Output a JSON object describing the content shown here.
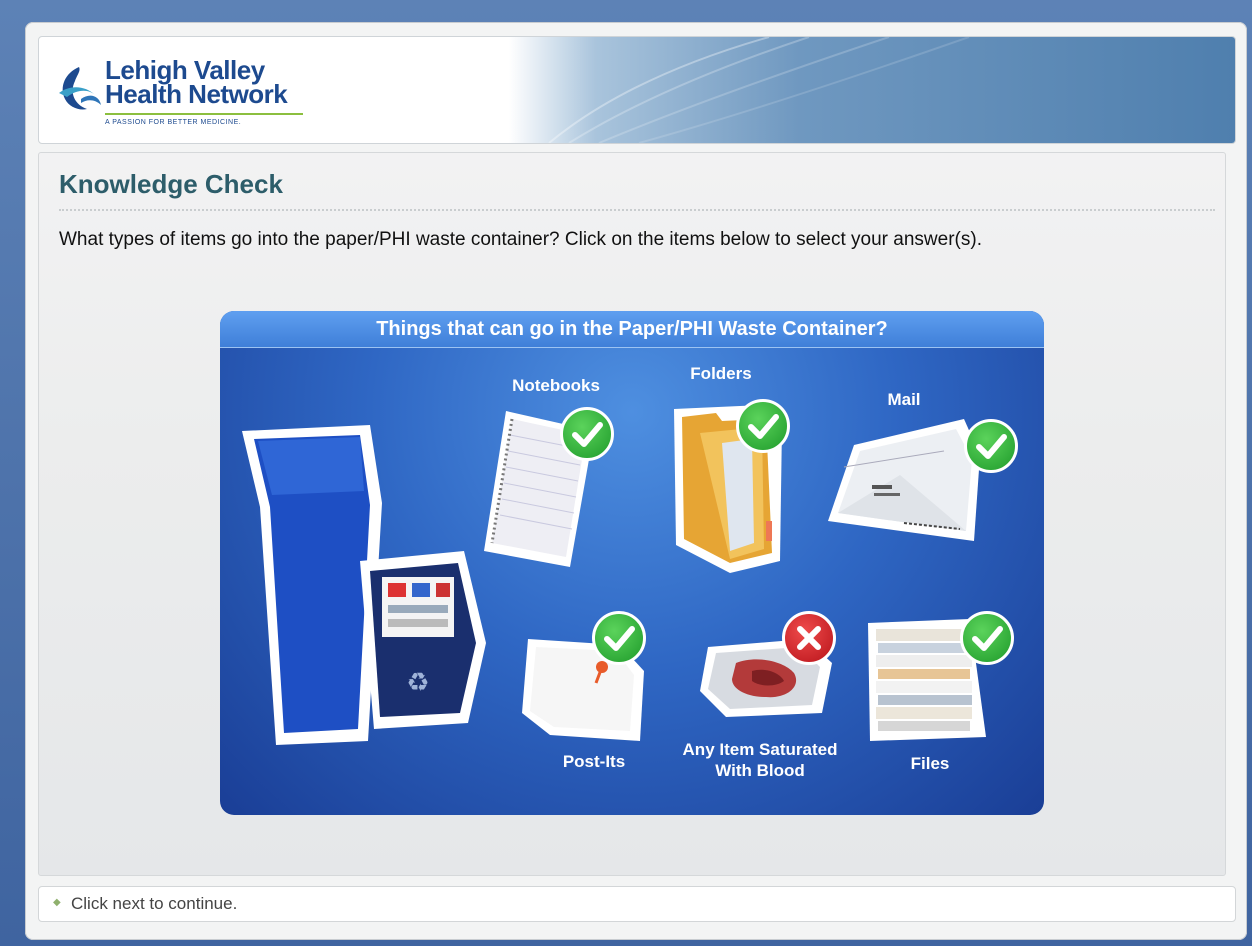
{
  "header": {
    "logo_line1": "Lehigh Valley",
    "logo_line2": "Health Network",
    "logo_tagline": "A PASSION FOR BETTER MEDICINE."
  },
  "main": {
    "title": "Knowledge Check",
    "question": "What types of items go into the paper/PHI waste container? Click on the items below to select your answer(s).",
    "panel_title": "Things that can go in the Paper/PHI Waste Container?",
    "items": [
      {
        "label": "Notebooks",
        "status": "check-icon"
      },
      {
        "label": "Folders",
        "status": "check-icon"
      },
      {
        "label": "Mail",
        "status": "check-icon"
      },
      {
        "label": "Post-Its",
        "status": "check-icon"
      },
      {
        "label": "Any Item Saturated\nWith Blood",
        "status": "x-icon"
      },
      {
        "label": "Files",
        "status": "check-icon"
      }
    ]
  },
  "footer": {
    "text": "Click next to continue."
  },
  "colors": {
    "title": "#2d5d6a",
    "panel": "#2f67c4",
    "correct": "#1e9a2a",
    "incorrect": "#b8131a"
  }
}
